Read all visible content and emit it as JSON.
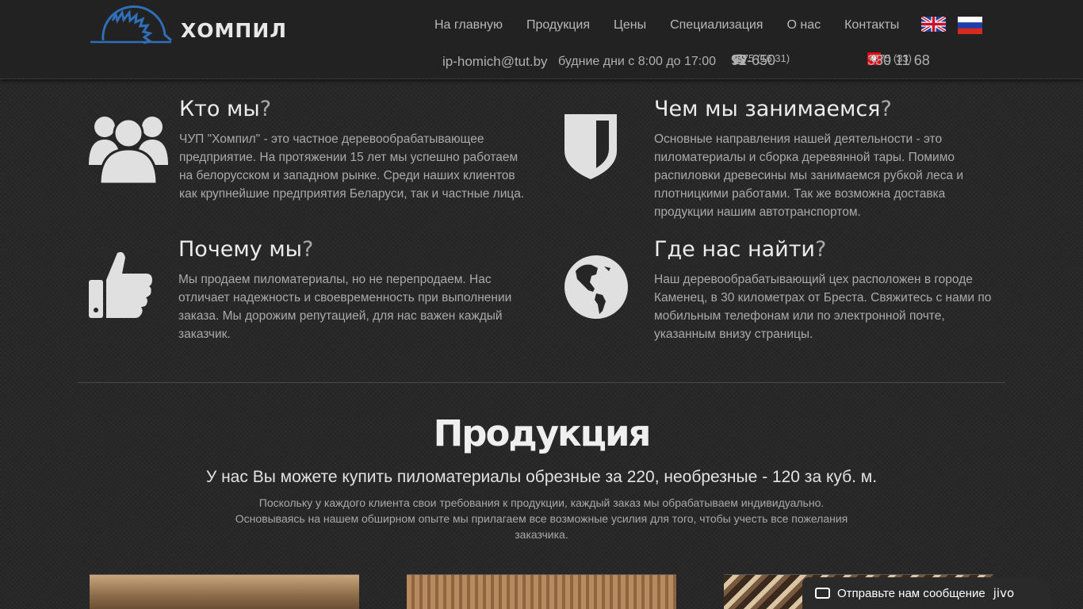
{
  "header": {
    "logo_text": "ХОМПИЛ",
    "nav": [
      {
        "label": "На главную"
      },
      {
        "label": "Продукция"
      },
      {
        "label": "Цены"
      },
      {
        "label": "Специализация"
      },
      {
        "label": "О нас"
      },
      {
        "label": "Контакты"
      }
    ],
    "languages": [
      "flag-uk-icon",
      "flag-ru-icon"
    ],
    "email": "ip-homich@tut.by",
    "hours": "будние дни с 8:00 до 17:00",
    "phone1_prefix": "+375 (16 31)",
    "phone1_number": "92-650",
    "phone2_prefix": "+375 (33)",
    "phone2_number": "330 11 68"
  },
  "features": [
    {
      "title": "Кто мы",
      "q": "?",
      "icon": "users-icon",
      "text": "ЧУП \"Хомпил\" - это частное деревообрабатывающее предприятие. На протяжении 15 лет мы успешно работаем на белорусском и западном рынке. Среди наших клиентов как крупнейшие предприятия Беларуси, так и частные лица."
    },
    {
      "title": "Чем мы занимаемся",
      "q": "?",
      "icon": "shield-icon",
      "text": "Основные направления нашей деятельности - это пиломатериалы и сборка деревянной тары. Помимо распиловки древесины мы занимаемся рубкой леса и плотницкими работами. Так же возможна доставка продукции нашим автотранспортом."
    },
    {
      "title": "Почему мы",
      "q": "?",
      "icon": "thumbs-up-icon",
      "text": "Мы продаем пиломатериалы, но не перепродаем. Нас отличает надежность и своевременность при выполнении заказа. Мы дорожим репутацией, для нас важен каждый заказчик."
    },
    {
      "title": "Где нас найти",
      "q": "?",
      "icon": "globe-icon",
      "text": "Наш деревообрабатывающий цех расположен в городе Каменец, в 30 километрах от Бреста. Свяжитесь с нами по мобильным телефонам или по электронной почте, указанным внизу страницы."
    }
  ],
  "products": {
    "title": "Продукция",
    "subtitle": "У нас Вы можете купить пиломатериалы обрезные за 220, необрезные - 120 за куб. м.",
    "description": "Поскольку у каждого клиента свои требования к продукции, каждый заказ мы обрабатываем индивидуально. Основываясь на нашем обширном опыте мы прилагаем все возможные усилия для того, чтобы учесть все пожелания заказчика."
  },
  "chat": {
    "label": "Отправьте нам сообщение",
    "brand": "jivo"
  }
}
